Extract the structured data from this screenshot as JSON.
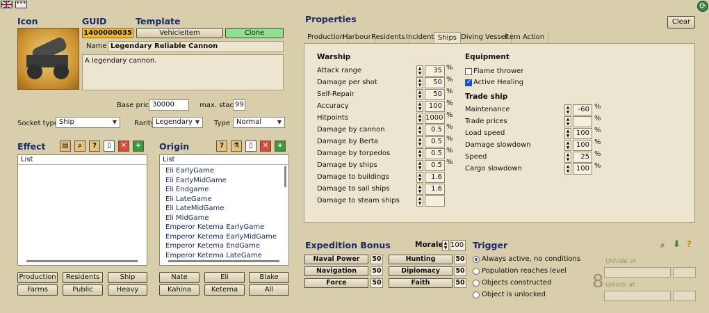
{
  "left": {
    "icon_title": "Icon",
    "guid_title": "GUID",
    "template_title": "Template",
    "guid_value": "1400000035",
    "template_value": "VehicleItem",
    "clone_label": "Clone",
    "name_label": "Name",
    "name_value": "Legendary Reliable Cannon",
    "description": "A legendary cannon.",
    "base_price_label": "Base price",
    "base_price_value": "30000",
    "max_stack_label": "max. stack",
    "max_stack_value": "99",
    "socket_type_label": "Socket type",
    "socket_type_value": "Ship",
    "rarity_label": "Rarity",
    "rarity_value": "Legendary",
    "type_label": "Type",
    "type_value": "Normal"
  },
  "effect": {
    "title": "Effect",
    "list_header": "List",
    "buttons": [
      "Production",
      "Residents",
      "Ship",
      "Farms",
      "Public",
      "Heavy"
    ]
  },
  "origin": {
    "title": "Origin",
    "list_header": "List",
    "items": [
      "Eli EarlyGame",
      "Eli EarlyMidGame",
      "Eli Endgame",
      "Eli LateGame",
      "Eli LateMidGame",
      "Eli MidGame",
      "Emperor Ketema EarlyGame",
      "Emperor Ketema EarlyMidGame",
      "Emperor Ketema EndGame",
      "Emperor Ketema LateGame"
    ],
    "buttons": [
      "Nate",
      "Eli",
      "Blake",
      "Kahina",
      "Ketema",
      "All"
    ]
  },
  "properties": {
    "title": "Properties",
    "clear_label": "Clear",
    "tabs": [
      "Production",
      "Harbour",
      "Residents",
      "Incidents",
      "Ships",
      "Diving Vessel",
      "Item Action"
    ],
    "active_tab": "Ships",
    "warship_title": "Warship",
    "warship": [
      {
        "label": "Attack range",
        "value": "35",
        "unit": "%"
      },
      {
        "label": "Damage per shot",
        "value": "50",
        "unit": "%"
      },
      {
        "label": "Self-Repair",
        "value": "50",
        "unit": "%"
      },
      {
        "label": "Accuracy",
        "value": "100",
        "unit": "%"
      },
      {
        "label": "Hitpoints",
        "value": "1000",
        "unit": "%"
      },
      {
        "label": "Damage by cannon",
        "value": "0.5",
        "unit": "%"
      },
      {
        "label": "Damage by Berta",
        "value": "0.5",
        "unit": "%"
      },
      {
        "label": "Damage by torpedos",
        "value": "0.5",
        "unit": "%"
      },
      {
        "label": "Damage by ships",
        "value": "0.5",
        "unit": "%"
      },
      {
        "label": "Damage to buildings",
        "value": "1.6",
        "unit": ""
      },
      {
        "label": "Damage to sail ships",
        "value": "1.6",
        "unit": ""
      },
      {
        "label": "Damage to steam ships",
        "value": "",
        "unit": ""
      }
    ],
    "equipment_title": "Equipment",
    "equipment": [
      {
        "label": "Flame thrower",
        "checked": false
      },
      {
        "label": "Active Healing",
        "checked": true
      }
    ],
    "tradeship_title": "Trade ship",
    "tradeship": [
      {
        "label": "Maintenance",
        "value": "-60",
        "unit": "%"
      },
      {
        "label": "Trade prices",
        "value": "",
        "unit": "%"
      },
      {
        "label": "Load speed",
        "value": "100",
        "unit": "%"
      },
      {
        "label": "Damage slowdown",
        "value": "100",
        "unit": "%"
      },
      {
        "label": "Speed",
        "value": "25",
        "unit": "%"
      },
      {
        "label": "Cargo slowdown",
        "value": "100",
        "unit": "%"
      }
    ]
  },
  "expedition": {
    "title": "Expedition Bonus",
    "morale_label": "Morale",
    "morale_value": "100",
    "bonuses": [
      {
        "label": "Naval Power",
        "value": "50"
      },
      {
        "label": "Hunting",
        "value": "50"
      },
      {
        "label": "Navigation",
        "value": "50"
      },
      {
        "label": "Diplomacy",
        "value": "50"
      },
      {
        "label": "Force",
        "value": "50"
      },
      {
        "label": "Faith",
        "value": "50"
      }
    ]
  },
  "trigger": {
    "title": "Trigger",
    "options": [
      {
        "label": "Always active, no conditions",
        "selected": true
      },
      {
        "label": "Population reaches level",
        "selected": false
      },
      {
        "label": "Objects constructed",
        "selected": false
      },
      {
        "label": "Object is unlocked",
        "selected": false
      }
    ],
    "unhide_label": "Unhide at",
    "unlock_label": "Unlock at"
  },
  "colors": {
    "background": "#d8ceab",
    "guid_bg": "#f0b830",
    "clone_bg": "#8fe08f",
    "accent_blue": "#1a2a66"
  }
}
